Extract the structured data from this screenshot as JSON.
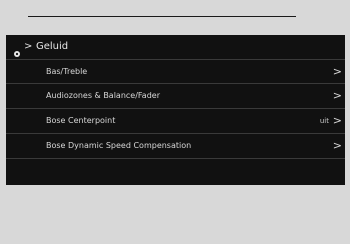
{
  "header": {
    "title": "Geluid",
    "separator": ">"
  },
  "menu": {
    "items": [
      {
        "label": "Bas/Treble",
        "chevron": ">"
      },
      {
        "label": "Audiozones & Balance/Fader",
        "chevron": ">"
      },
      {
        "label": "Bose Centerpoint",
        "state": "uit",
        "chevron": ">"
      },
      {
        "label": "Bose Dynamic Speed Compensation",
        "chevron": ">"
      }
    ]
  },
  "icons": {
    "header_icon": "gear-icon",
    "row_icon": "chevron-right-icon"
  },
  "colors": {
    "screen_bg": "#111111",
    "frame_bg": "#d8d8d8",
    "text": "#d7d7d7",
    "divider": "#3a3a3a"
  }
}
